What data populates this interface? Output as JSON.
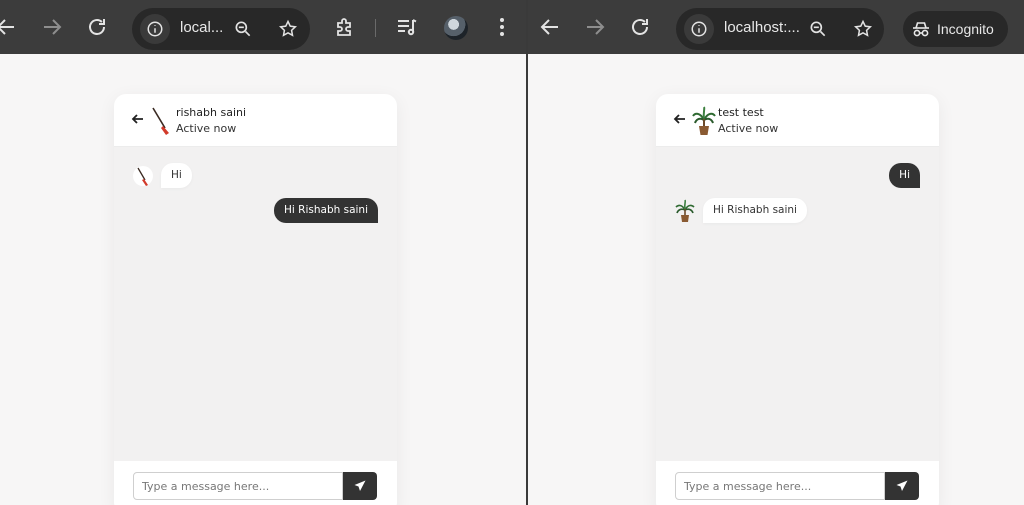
{
  "windows": [
    {
      "name": "left-window",
      "omnibox": {
        "url": "local..."
      },
      "chat": {
        "contact_name": "rishabh saini",
        "status": "Active now",
        "messages": [
          {
            "direction": "in",
            "text": "Hi"
          },
          {
            "direction": "out",
            "text": "Hi Rishabh saini"
          }
        ],
        "input_placeholder": "Type a message here..."
      }
    },
    {
      "name": "right-window",
      "omnibox": {
        "url": "localhost:..."
      },
      "incognito_label": "Incognito",
      "chat": {
        "contact_name": "test test",
        "status": "Active now",
        "messages": [
          {
            "direction": "out",
            "text": "Hi"
          },
          {
            "direction": "in",
            "text": "Hi Rishabh saini"
          }
        ],
        "input_placeholder": "Type a message here..."
      }
    }
  ],
  "icons": {
    "back": "arrow-left-icon",
    "forward": "arrow-right-icon",
    "reload": "reload-icon",
    "site_info": "info-icon",
    "zoom": "zoom-out-icon",
    "bookmark": "star-icon",
    "extensions": "puzzle-icon",
    "media": "playlist-music-icon",
    "menu": "kebab-menu-icon",
    "send": "paper-plane-icon",
    "incognito": "incognito-icon"
  },
  "colors": {
    "toolbar": "#3c3c3c",
    "omnibox": "#282828",
    "page_bg": "#f7f6f6",
    "card_bg": "#f2f1f1",
    "outgoing_bubble": "#333333",
    "incoming_bubble": "#ffffff"
  }
}
